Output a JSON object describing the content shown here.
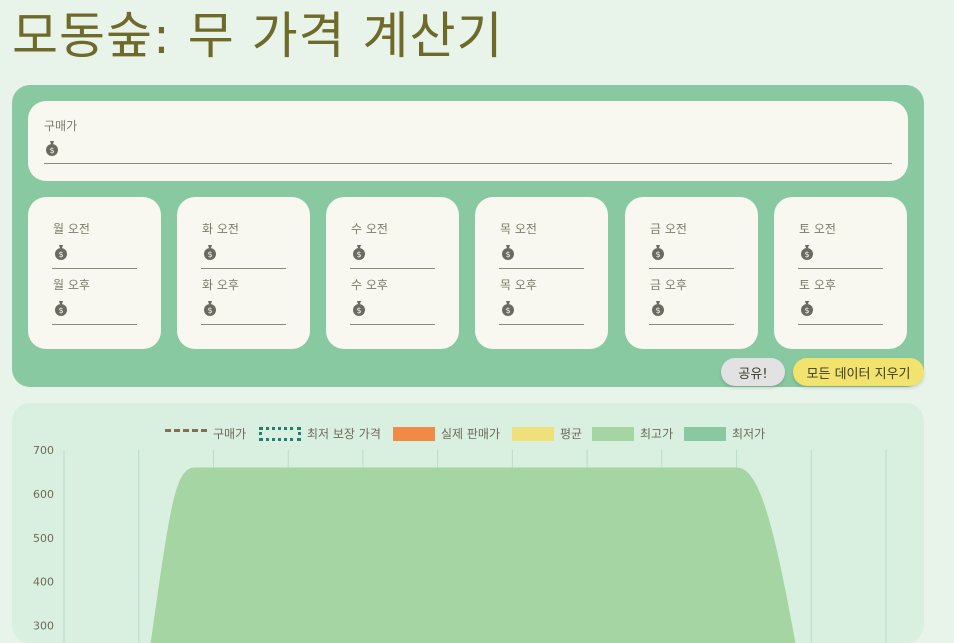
{
  "title": "모동숲: 무 가격 계산기",
  "buy_price": {
    "label": "구매가",
    "value": ""
  },
  "days": [
    {
      "am_label": "월 오전",
      "pm_label": "월 오후",
      "am_value": "",
      "pm_value": ""
    },
    {
      "am_label": "화 오전",
      "pm_label": "화 오후",
      "am_value": "",
      "pm_value": ""
    },
    {
      "am_label": "수 오전",
      "pm_label": "수 오후",
      "am_value": "",
      "pm_value": ""
    },
    {
      "am_label": "목 오전",
      "pm_label": "목 오후",
      "am_value": "",
      "pm_value": ""
    },
    {
      "am_label": "금 오전",
      "pm_label": "금 오후",
      "am_value": "",
      "pm_value": ""
    },
    {
      "am_label": "토 오전",
      "pm_label": "토 오후",
      "am_value": "",
      "pm_value": ""
    }
  ],
  "buttons": {
    "share": "공유!",
    "clear": "모든 데이터 지우기"
  },
  "colors": {
    "panel": "#88c9a1",
    "title": "#6f6a2a",
    "actual": "#f08a45",
    "average": "#efe07a",
    "max": "#a6d5a4",
    "min": "#88c9a1",
    "share_button": "#e2e2e2",
    "clear_button": "#f2e26e"
  },
  "icons": {
    "bell_bag": "money-bag-icon"
  },
  "chart_data": {
    "type": "area",
    "legend": [
      "구매가",
      "최저 보장 가격",
      "실제 판매가",
      "평균",
      "최고가",
      "최저가"
    ],
    "y_ticks": [
      "700",
      "600",
      "500",
      "400",
      "300"
    ],
    "ylim": [
      250,
      700
    ],
    "x": [
      0,
      1,
      2,
      3,
      4,
      5,
      6,
      7,
      8,
      9,
      10,
      11
    ],
    "series": [
      {
        "name": "최고가",
        "values": [
          0,
          0,
          660,
          660,
          660,
          660,
          660,
          660,
          660,
          660,
          0,
          0
        ]
      }
    ]
  }
}
